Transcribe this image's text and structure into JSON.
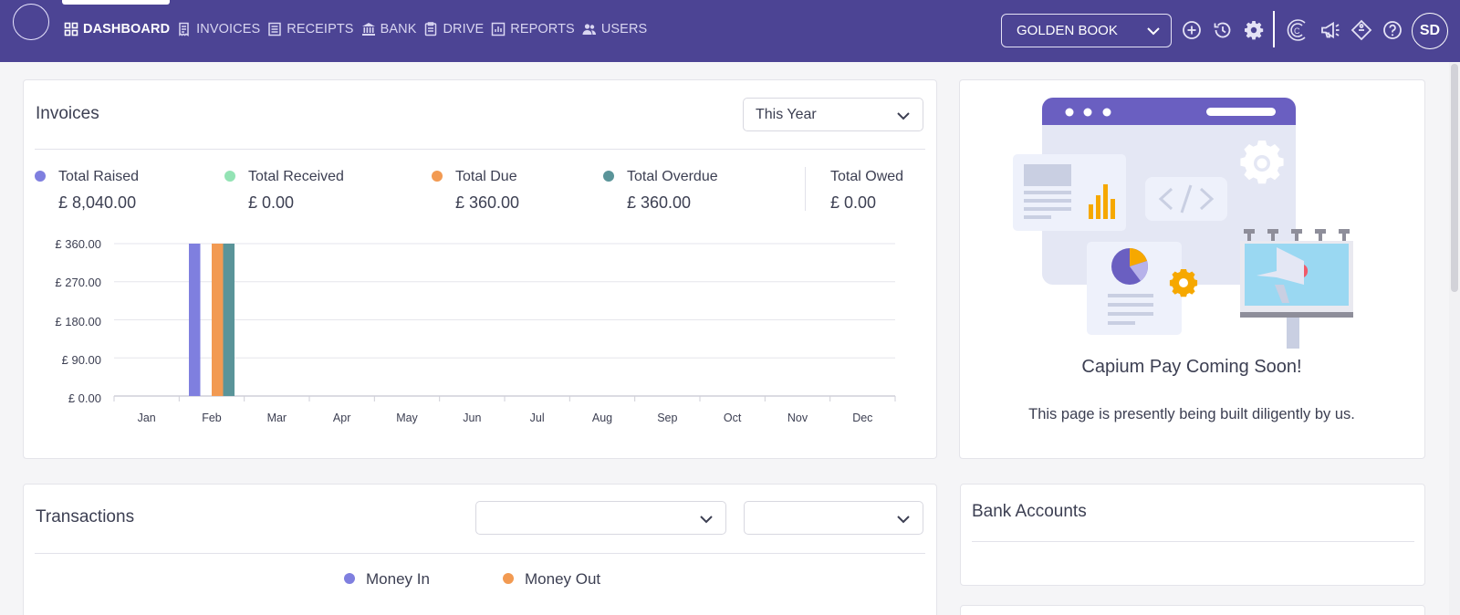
{
  "nav": {
    "items": [
      {
        "label": "DASHBOARD",
        "icon": "grid-icon"
      },
      {
        "label": "INVOICES",
        "icon": "invoice-icon"
      },
      {
        "label": "RECEIPTS",
        "icon": "receipt-icon"
      },
      {
        "label": "BANK",
        "icon": "bank-icon"
      },
      {
        "label": "DRIVE",
        "icon": "drive-icon"
      },
      {
        "label": "REPORTS",
        "icon": "reports-icon"
      },
      {
        "label": "USERS",
        "icon": "users-icon"
      }
    ],
    "active": "DASHBOARD"
  },
  "header": {
    "book_select": "GOLDEN BOOK",
    "avatar_initials": "SD",
    "icons": [
      "add-circle-icon",
      "history-icon",
      "gear-icon",
      "capium-c-icon",
      "megaphone-icon",
      "tag-icon",
      "help-icon"
    ]
  },
  "invoices": {
    "title": "Invoices",
    "period": "This Year",
    "stats": [
      {
        "label": "Total Raised",
        "value": "£ 8,040.00",
        "color": "#7f7fdf"
      },
      {
        "label": "Total Received",
        "value": "£ 0.00",
        "color": "#93e3b4"
      },
      {
        "label": "Total Due",
        "value": "£ 360.00",
        "color": "#f29a52"
      },
      {
        "label": "Total Overdue",
        "value": "£ 360.00",
        "color": "#5a9499"
      },
      {
        "label": "Total Owed",
        "value": "£ 0.00"
      }
    ]
  },
  "chart_data": {
    "type": "bar",
    "categories": [
      "Jan",
      "Feb",
      "Mar",
      "Apr",
      "May",
      "Jun",
      "Jul",
      "Aug",
      "Sep",
      "Oct",
      "Nov",
      "Dec"
    ],
    "series": [
      {
        "name": "Total Raised",
        "color": "#7f7fdf",
        "values": [
          0,
          360,
          0,
          0,
          0,
          0,
          0,
          0,
          0,
          0,
          0,
          0
        ]
      },
      {
        "name": "Total Received",
        "color": "#93e3b4",
        "values": [
          0,
          0,
          0,
          0,
          0,
          0,
          0,
          0,
          0,
          0,
          0,
          0
        ]
      },
      {
        "name": "Total Due",
        "color": "#f29a52",
        "values": [
          0,
          360,
          0,
          0,
          0,
          0,
          0,
          0,
          0,
          0,
          0,
          0
        ]
      },
      {
        "name": "Total Overdue",
        "color": "#5a9499",
        "values": [
          0,
          360,
          0,
          0,
          0,
          0,
          0,
          0,
          0,
          0,
          0,
          0
        ]
      }
    ],
    "y_ticks": [
      "£ 0.00",
      "£ 90.00",
      "£ 180.00",
      "£ 270.00",
      "£ 360.00"
    ],
    "ylim": [
      0,
      360
    ],
    "grid": true
  },
  "promo": {
    "title": "Capium Pay Coming Soon!",
    "text": "This page is presently being built diligently by us."
  },
  "transactions": {
    "title": "Transactions",
    "select1": "",
    "select2": "",
    "legend": [
      {
        "label": "Money In",
        "color": "#7f7fdf"
      },
      {
        "label": "Money Out",
        "color": "#f29a52"
      }
    ]
  },
  "bank": {
    "title": "Bank Accounts"
  },
  "colors": {
    "brand": "#4c4494",
    "accent": "#6a5fc1"
  }
}
